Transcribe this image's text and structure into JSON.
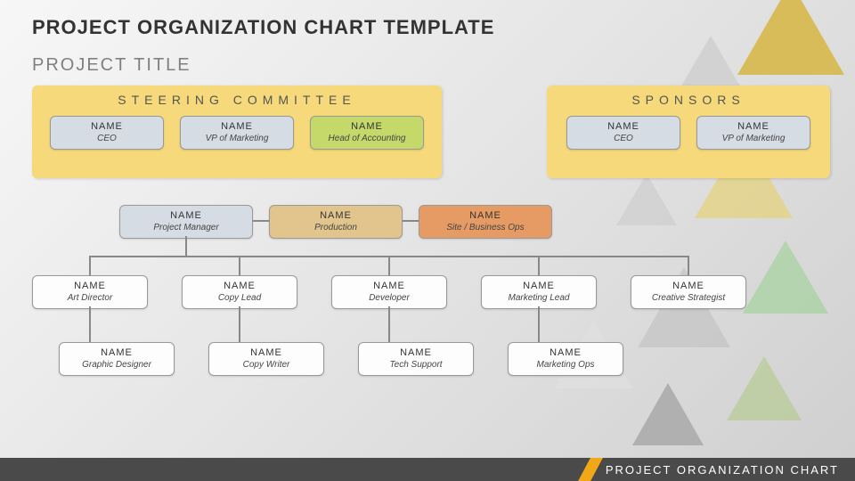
{
  "header": {
    "title": "PROJECT ORGANIZATION CHART TEMPLATE",
    "subtitle": "PROJECT TITLE"
  },
  "steering": {
    "label": "STEERING COMMITTEE",
    "members": [
      {
        "name": "NAME",
        "role": "CEO"
      },
      {
        "name": "NAME",
        "role": "VP of Marketing"
      },
      {
        "name": "NAME",
        "role": "Head of Accounting"
      }
    ]
  },
  "sponsors": {
    "label": "SPONSORS",
    "members": [
      {
        "name": "NAME",
        "role": "CEO"
      },
      {
        "name": "NAME",
        "role": "VP of Marketing"
      }
    ]
  },
  "org": {
    "leads": [
      {
        "name": "NAME",
        "role": "Project Manager"
      },
      {
        "name": "NAME",
        "role": "Production"
      },
      {
        "name": "NAME",
        "role": "Site / Business Ops"
      }
    ],
    "tier2": [
      {
        "name": "NAME",
        "role": "Art Director"
      },
      {
        "name": "NAME",
        "role": "Copy Lead"
      },
      {
        "name": "NAME",
        "role": "Developer"
      },
      {
        "name": "NAME",
        "role": "Marketing Lead"
      },
      {
        "name": "NAME",
        "role": "Creative Strategist"
      }
    ],
    "tier3": [
      {
        "name": "NAME",
        "role": "Graphic Designer"
      },
      {
        "name": "NAME",
        "role": "Copy Writer"
      },
      {
        "name": "NAME",
        "role": "Tech Support"
      },
      {
        "name": "NAME",
        "role": "Marketing Ops"
      }
    ]
  },
  "footer": {
    "label": "PROJECT ORGANIZATION CHART"
  }
}
